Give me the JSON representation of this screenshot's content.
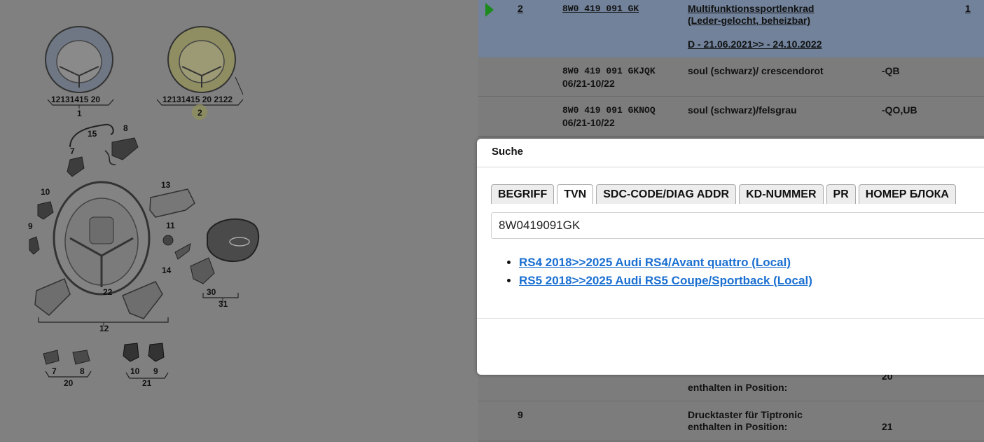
{
  "diagram": {
    "callouts": {
      "g1": "12131415 20",
      "g1_num": "1",
      "g2": "12131415 20 2122",
      "g2_num": "2",
      "p15": "15",
      "p8": "8",
      "p7": "7",
      "p10": "10",
      "p13": "13",
      "p9": "9",
      "p11": "11",
      "p14": "14",
      "p22": "22",
      "p30": "30",
      "p31": "31",
      "p12": "12",
      "b7": "7",
      "b8": "8",
      "b20": "20",
      "b10": "10",
      "b9": "9",
      "b21": "21"
    }
  },
  "parts": {
    "row1": {
      "pos": "2",
      "part": "8W0 419 091 GK",
      "desc1": "Multifunktionssportlenkrad",
      "desc2": "(Leder-gelocht, beheizbar)",
      "date": "D - 21.06.2021>> - 24.10.2022",
      "qty": "1"
    },
    "row2": {
      "part": "8W0 419 091 GKJQK",
      "date": "06/21-10/22",
      "desc": "soul (schwarz)/ crescendorot",
      "pr": "-QB"
    },
    "row3": {
      "part": "8W0 419 091 GKNOQ",
      "date": "06/21-10/22",
      "desc": "soul (schwarz)/felsgrau",
      "pr": "-QO,UB"
    },
    "row4": {
      "desc": "enthalten in Position:",
      "pr": "20"
    },
    "row5": {
      "pos": "9",
      "desc1": "Drucktaster für Tiptronic",
      "desc2": "enthalten in Position:",
      "pr": "21"
    }
  },
  "modal": {
    "title": "Suche",
    "tabs": [
      "BEGRIFF",
      "TVN",
      "SDC-CODE/DIAG ADDR",
      "KD-NUMMER",
      "PR",
      "НОМЕР БЛОКА"
    ],
    "search_value": "8W0419091GK",
    "results": [
      "RS4 2018>>2025 Audi RS4/Avant quattro (Local)",
      "RS5 2018>>2025 Audi RS5 Coupe/Sportback (Local)"
    ]
  }
}
